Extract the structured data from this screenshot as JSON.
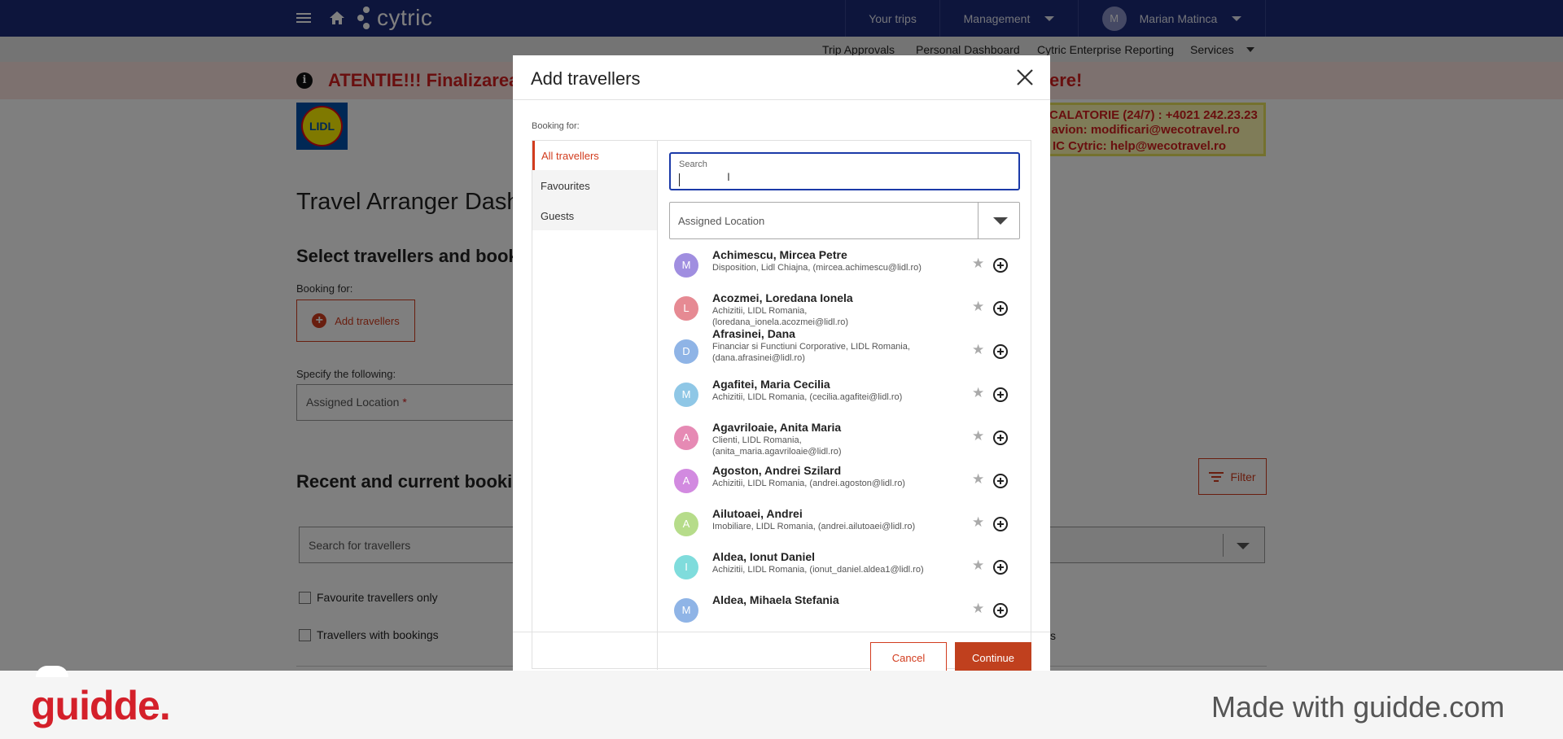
{
  "topbar": {
    "brand": "cytric",
    "your_trips": "Your trips",
    "management": "Management",
    "user_initial": "M",
    "user_name": "Marian Matinca"
  },
  "subnav": {
    "items": [
      "Trip Approvals",
      "Personal Dashboard",
      "Cytric Enterprise Reporting",
      "Services"
    ]
  },
  "alert": {
    "text_left": "ATENTIE!!! Finalizarea",
    "text_right": "ere!"
  },
  "lidl_logo": "LIDL",
  "contact": {
    "line1": "CALATORIE (24/7) : +4021 242.23.23",
    "line2": "e avion:  modificari@wecotravel.ro",
    "line3": "IC Cytric:  help@wecotravel.ro"
  },
  "background": {
    "title": "Travel Arranger Dash",
    "select_heading": "Select travellers and book",
    "booking_for": "Booking for:",
    "add_travellers": "Add travellers",
    "specify": "Specify the following:",
    "assigned_location": "Assigned Location",
    "required_mark": "*",
    "recent_heading": "Recent and current bookin",
    "filter": "Filter",
    "search_placeholder": "Search for travellers",
    "favourite_only": "Favourite travellers only",
    "with_bookings": "Travellers with bookings",
    "stray_s": "s"
  },
  "modal": {
    "title": "Add travellers",
    "booking_for": "Booking for:",
    "tabs": [
      "All travellers",
      "Favourites",
      "Guests"
    ],
    "search_label": "Search",
    "location_label": "Assigned Location",
    "cancel": "Cancel",
    "continue": "Continue",
    "travellers": [
      {
        "initial": "M",
        "color": "#a08ee0",
        "name": "Achimescu, Mircea Petre",
        "details": "Disposition, Lidl Chiajna, (mircea.achimescu@lidl.ro)"
      },
      {
        "initial": "L",
        "color": "#e68a93",
        "name": "Acozmei, Loredana Ionela",
        "details": "Achizitii, LIDL Romania, (loredana_ionela.acozmei@lidl.ro)"
      },
      {
        "initial": "D",
        "color": "#8fb4e6",
        "name": "Afrasinei, Dana",
        "details": "Financiar si Functiuni Corporative, LIDL Romania, (dana.afrasinei@lidl.ro)"
      },
      {
        "initial": "M",
        "color": "#8fc7e6",
        "name": "Agafitei, Maria Cecilia",
        "details": "Achizitii, LIDL Romania, (cecilia.agafitei@lidl.ro)"
      },
      {
        "initial": "A",
        "color": "#e68ab4",
        "name": "Agavriloaie, Anita Maria",
        "details": "Clienti, LIDL Romania, (anita_maria.agavriloaie@lidl.ro)"
      },
      {
        "initial": "A",
        "color": "#d28ae0",
        "name": "Agoston, Andrei Szilard",
        "details": "Achizitii, LIDL Romania, (andrei.agoston@lidl.ro)"
      },
      {
        "initial": "A",
        "color": "#b6dc8a",
        "name": "Ailutoaei, Andrei",
        "details": "Imobiliare, LIDL Romania, (andrei.ailutoaei@lidl.ro)"
      },
      {
        "initial": "I",
        "color": "#7fdcdc",
        "name": "Aldea, Ionut Daniel",
        "details": "Achizitii, LIDL Romania, (ionut_daniel.aldea1@lidl.ro)"
      },
      {
        "initial": "M",
        "color": "#8fb4e6",
        "name": "Aldea, Mihaela Stefania",
        "details": ""
      }
    ]
  },
  "footer": {
    "brand": "guidde.",
    "made_with": "Made with guidde.com"
  }
}
